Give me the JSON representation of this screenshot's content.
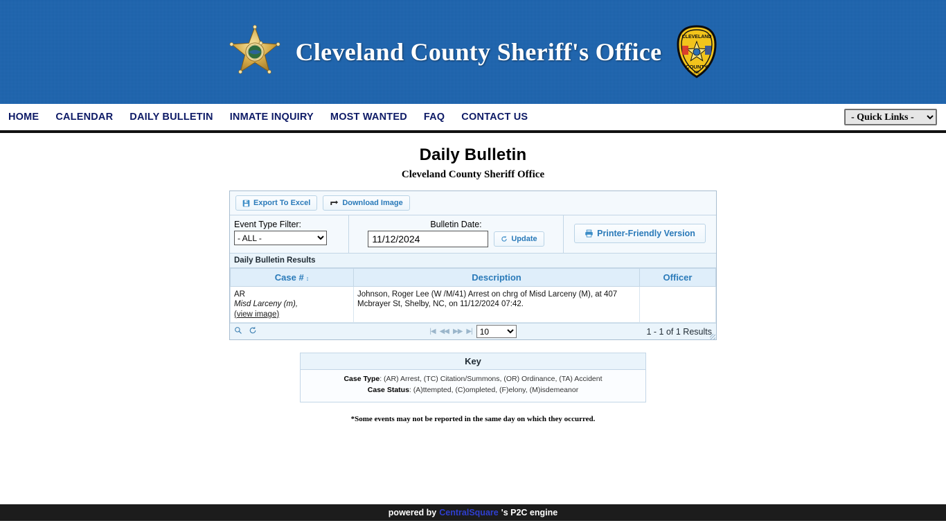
{
  "header": {
    "site_title": "Cleveland County Sheriff's Office",
    "left_badge": "sheriff-star-badge",
    "right_badge": "cleveland-county-shield-patch"
  },
  "nav": {
    "items": [
      {
        "label": "HOME"
      },
      {
        "label": "CALENDAR"
      },
      {
        "label": "DAILY BULLETIN"
      },
      {
        "label": "INMATE INQUIRY"
      },
      {
        "label": "MOST WANTED"
      },
      {
        "label": "FAQ"
      },
      {
        "label": "CONTACT US"
      }
    ],
    "quick_links_selected": "- Quick Links -"
  },
  "page": {
    "title": "Daily Bulletin",
    "subtitle": "Cleveland County Sheriff Office"
  },
  "toolbar": {
    "export_excel_label": "Export To Excel",
    "download_image_label": "Download Image"
  },
  "filters": {
    "event_type_label": "Event Type Filter:",
    "event_type_selected": "- ALL -",
    "bulletin_date_label": "Bulletin Date:",
    "bulletin_date_value": "11/12/2024",
    "update_label": "Update",
    "printer_friendly_label": "Printer-Friendly Version"
  },
  "results": {
    "grid_title": "Daily Bulletin Results",
    "columns": [
      "Case #",
      "Description",
      "Officer"
    ],
    "sort_indicator": "↕",
    "rows": [
      {
        "case_type": "AR",
        "case_charge": "Misd Larceny (m),",
        "view_image_label": "(view image)",
        "description": "Johnson, Roger Lee (W /M/41) Arrest on chrg of Misd Larceny (M), at 407 Mcbrayer St, Shelby, NC, on 11/12/2024 07:42.",
        "officer": ""
      }
    ],
    "page_size": "10",
    "results_count": "1 - 1 of 1 Results"
  },
  "key": {
    "heading": "Key",
    "case_type_label": "Case Type",
    "case_type_text": ": (AR) Arrest, (TC) Citation/Summons, (OR) Ordinance, (TA) Accident",
    "case_status_label": "Case Status",
    "case_status_text": ": (A)ttempted, (C)ompleted, (F)elony, (M)isdemeanor",
    "footnote": "*Some events may not be reported in the same day on which they occurred."
  },
  "footer": {
    "prefix": "powered by",
    "brand": "CentralSquare",
    "suffix": "'s P2C engine"
  },
  "colors": {
    "header_blue": "#1a63b0",
    "nav_text": "#0d1a66",
    "accent_blue": "#2a7ab9",
    "link_blue": "#2f3fd0",
    "grid_header_bg": "#dfeefa"
  }
}
